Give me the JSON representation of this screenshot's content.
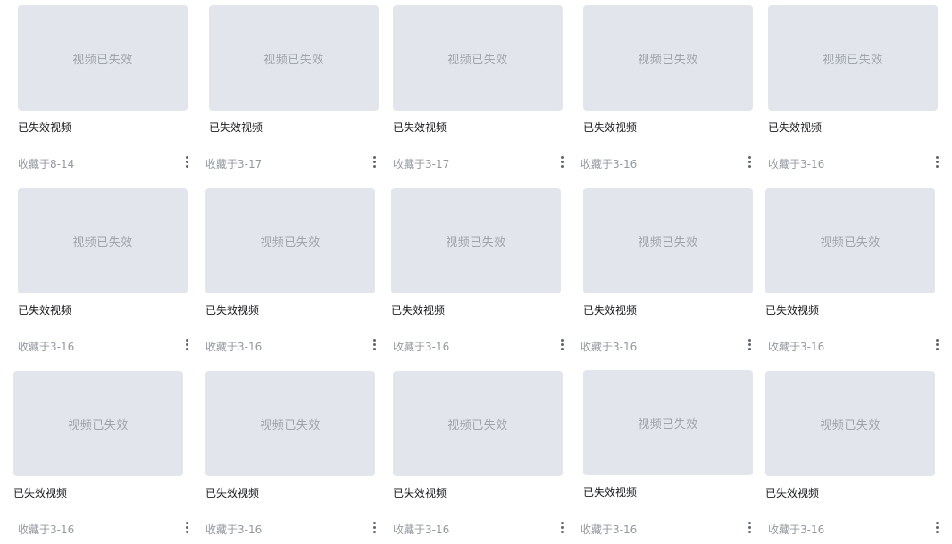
{
  "colors": {
    "thumb_bg": "#e3e5ec",
    "thumb_text": "#9fa3ab",
    "title_text": "#18191c",
    "meta_text": "#9499a0",
    "more_icon": "#61666d"
  },
  "icons": {
    "more": "more-vertical-icon"
  },
  "favorites": {
    "items": [
      {
        "thumb_label": "视频已失效",
        "title": "已失效视频",
        "meta": "收藏于8-14"
      },
      {
        "thumb_label": "视频已失效",
        "title": "已失效视频",
        "meta": "收藏于3-17"
      },
      {
        "thumb_label": "视频已失效",
        "title": "已失效视频",
        "meta": "收藏于3-17"
      },
      {
        "thumb_label": "视频已失效",
        "title": "已失效视频",
        "meta": "收藏于3-16"
      },
      {
        "thumb_label": "视频已失效",
        "title": "已失效视频",
        "meta": "收藏于3-16"
      },
      {
        "thumb_label": "视频已失效",
        "title": "已失效视频",
        "meta": "收藏于3-16"
      },
      {
        "thumb_label": "视频已失效",
        "title": "已失效视频",
        "meta": "收藏于3-16"
      },
      {
        "thumb_label": "视频已失效",
        "title": "已失效视频",
        "meta": "收藏于3-16"
      },
      {
        "thumb_label": "视频已失效",
        "title": "已失效视频",
        "meta": "收藏于3-16"
      },
      {
        "thumb_label": "视频已失效",
        "title": "已失效视频",
        "meta": "收藏于3-16"
      },
      {
        "thumb_label": "视频已失效",
        "title": "已失效视频",
        "meta": "收藏于3-16"
      },
      {
        "thumb_label": "视频已失效",
        "title": "已失效视频",
        "meta": "收藏于3-16"
      },
      {
        "thumb_label": "视频已失效",
        "title": "已失效视频",
        "meta": "收藏于3-16"
      },
      {
        "thumb_label": "视频已失效",
        "title": "已失效视频",
        "meta": "收藏于3-16"
      },
      {
        "thumb_label": "视频已失效",
        "title": "已失效视频",
        "meta": "收藏于3-16"
      }
    ]
  }
}
